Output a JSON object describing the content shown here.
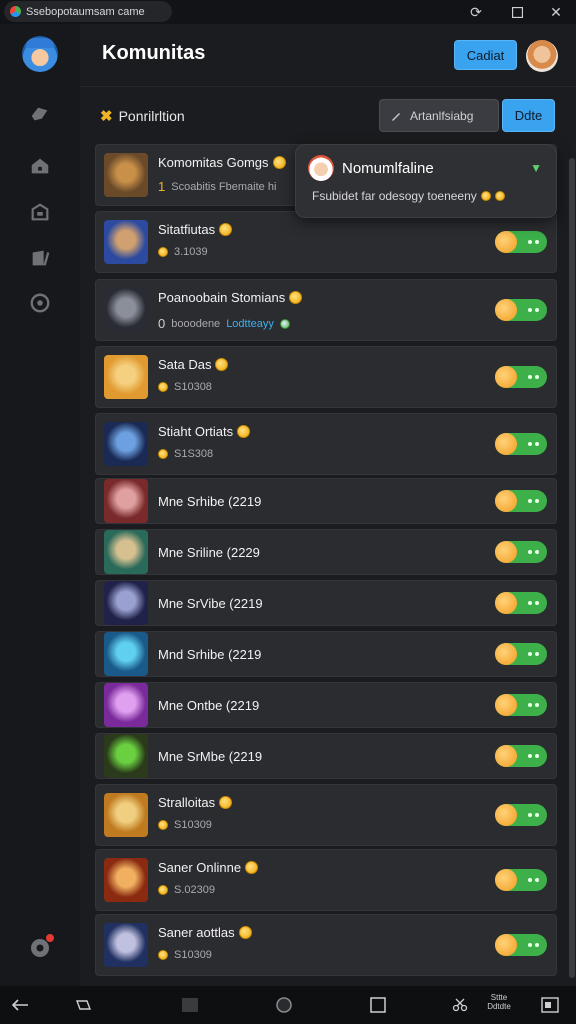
{
  "window": {
    "tab_title": "Ssebopotaumsam came",
    "icons": [
      "favicon",
      "refresh-icon",
      "maximize-icon",
      "close-icon"
    ]
  },
  "sidebar": {
    "icons": [
      "app-logo",
      "chat-icon",
      "home-icon",
      "store-icon",
      "library-icon",
      "controller-icon",
      "settings-icon"
    ]
  },
  "header": {
    "title": "Komunitas",
    "button_label": "Cadiat"
  },
  "toolbar": {
    "label": "Ponrilrltion",
    "search_label": "Artanlfsiabg",
    "action_label": "Ddte"
  },
  "popup": {
    "title": "Nomumlfaline",
    "subtitle": "Fsubidet far odesogy toeneeny"
  },
  "games": [
    {
      "title": "Komomitas Gomgs",
      "sub_prefix": "1",
      "sub": "Scoabitis  Fbemaite hi",
      "style": "featured"
    },
    {
      "title": "Sitatfiutas",
      "sub": "3.1039",
      "style": "coin"
    },
    {
      "title": "Poanoobain Stomians",
      "sub_prefix": "0",
      "sub": "booodene",
      "link": "Lodtteayy",
      "style": "link"
    },
    {
      "title": "Sata Das",
      "sub": "S10308",
      "style": "coin"
    },
    {
      "title": "Stiaht Ortiats",
      "sub": "S1S308",
      "style": "coin"
    },
    {
      "title": "Mne Srhibe (2219",
      "style": "plain"
    },
    {
      "title": "Mne Sriline (2229",
      "style": "plain"
    },
    {
      "title": "Mne SrVibe (2219",
      "style": "plain"
    },
    {
      "title": "Mnd Srhibe (2219",
      "style": "plain"
    },
    {
      "title": "Mne Ontbe (2219",
      "style": "plain"
    },
    {
      "title": "Mne SrMbe (2219",
      "style": "plain"
    },
    {
      "title": "Stralloitas",
      "sub": "S10309",
      "style": "coin"
    },
    {
      "title": "Saner Onlinne",
      "sub": "S.02309",
      "style": "coin"
    },
    {
      "title": "Saner aottlas",
      "sub": "S10309",
      "style": "coin"
    }
  ],
  "navbar": {
    "icons": [
      "back-icon",
      "speaker-icon",
      "recents-icon",
      "home-circle-icon",
      "square-icon",
      "scissors-icon",
      "screen-icon"
    ],
    "text": "Sttte Ddtdte"
  },
  "colors": {
    "background": "#1b1c1f",
    "accent_blue": "#3aa3ef",
    "toggle_green": "#3db04a",
    "coin_gold": "#f0a500"
  }
}
